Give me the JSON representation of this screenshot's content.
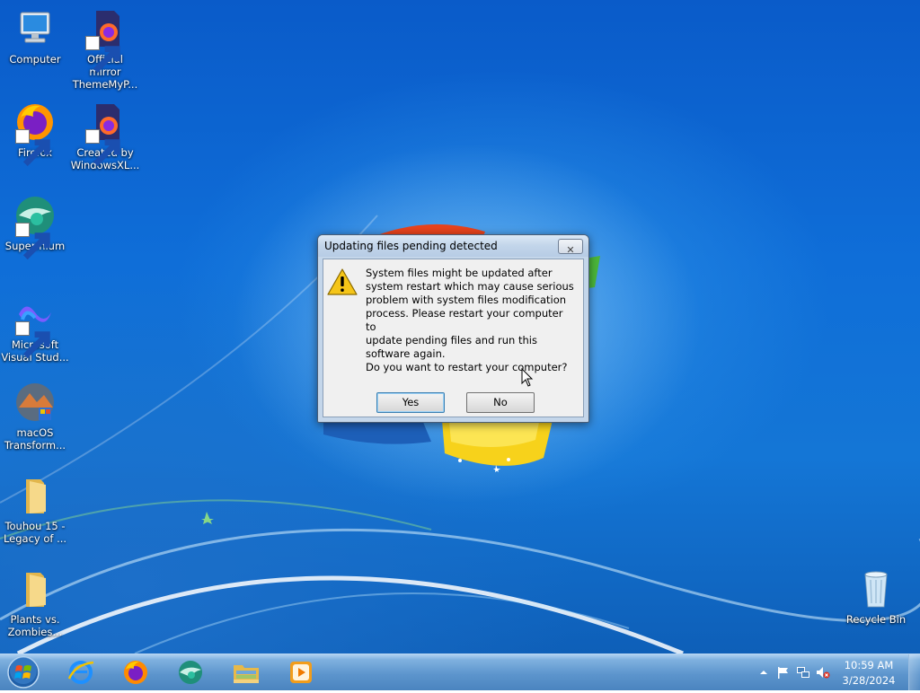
{
  "desktop": {
    "icons": [
      {
        "label": "Computer",
        "icon": "computer-icon"
      },
      {
        "label": "Official mirror ThemeMyP...",
        "icon": "firefox-dev-icon"
      },
      {
        "label": "Firefox",
        "icon": "firefox-icon"
      },
      {
        "label": "Created by WindowsXL...",
        "icon": "firefox-dev-icon"
      },
      {
        "label": "Supermium",
        "icon": "supermium-icon"
      },
      {
        "label": "Microsoft Visual Stud...",
        "icon": "visual-studio-icon"
      },
      {
        "label": "macOS Transform...",
        "icon": "macos-transformation-icon"
      },
      {
        "label": "Touhou 15 - Legacy of ...",
        "icon": "folder-icon"
      },
      {
        "label": "Plants vs. Zombies...",
        "icon": "folder-icon"
      },
      {
        "label": "Recycle Bin",
        "icon": "recycle-bin-icon"
      }
    ]
  },
  "dialog": {
    "title": "Updating files pending detected",
    "close_glyph": "✕",
    "message": "System files might be updated after\nsystem restart which may cause serious\nproblem with system files modification\nprocess. Please restart your computer to\nupdate pending files and run this\nsoftware again.",
    "question": "Do you want to restart your computer?",
    "yes_label": "Yes",
    "no_label": "No",
    "icon": "warning-icon"
  },
  "taskbar": {
    "start": "windows-start-orb",
    "pinned": [
      "internet-explorer-icon",
      "firefox-icon",
      "supermium-icon",
      "file-explorer-icon",
      "media-player-icon"
    ],
    "tray": {
      "icons": [
        "show-hidden-icons-arrow",
        "action-center-flag-icon",
        "network-icon",
        "volume-muted-icon"
      ],
      "time": "10:59 AM",
      "date": "3/28/2024"
    }
  },
  "colors": {
    "desktop_blue": "#0f6ed8",
    "taskbar": "#5d95cd",
    "dialog_frame": "#c4d6ea"
  }
}
